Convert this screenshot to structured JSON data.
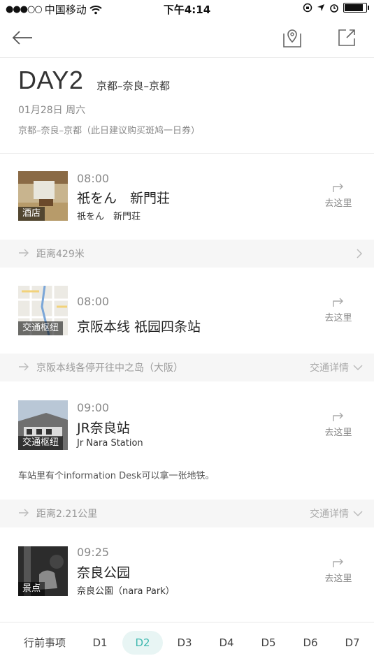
{
  "status_bar": {
    "carrier": "中国移动",
    "time": "下午4:14"
  },
  "header": {
    "day": "DAY2",
    "route": "京都–奈良–京都",
    "date": "01月28日 周六",
    "subroute": "京都–奈良–京都（此日建议购买斑鸠一日券）"
  },
  "cards": [
    {
      "tag": "酒店",
      "time": "08:00",
      "name": "祇をん　新門荘",
      "sub": "祇をん　新門荘",
      "goto": "去这里"
    },
    {
      "tag": "交通枢纽",
      "time": "08:00",
      "name": "京阪本线 祇园四条站",
      "sub": "",
      "goto": "去这里"
    },
    {
      "tag": "交通枢纽",
      "time": "09:00",
      "name": "JR奈良站",
      "sub": "Jr Nara Station",
      "goto": "去这里"
    },
    {
      "tag": "景点",
      "time": "09:25",
      "name": "奈良公园",
      "sub": "奈良公園（nara Park）",
      "goto": "去这里"
    }
  ],
  "bands": [
    {
      "label": "距离429米",
      "right": ""
    },
    {
      "label": "京阪本线各停开往中之岛（大阪）",
      "right": "交通详情"
    },
    {
      "label": "距离2.21公里",
      "right": "交通详情"
    }
  ],
  "note": "车站里有个information Desk可以拿一张地铁。",
  "tabs": {
    "pre": "行前事项",
    "d1": "D1",
    "d2": "D2",
    "d3": "D3",
    "d4": "D4",
    "d5": "D5",
    "d6": "D6",
    "d7": "D7"
  },
  "colors": {
    "accent": "#3fb8af"
  }
}
